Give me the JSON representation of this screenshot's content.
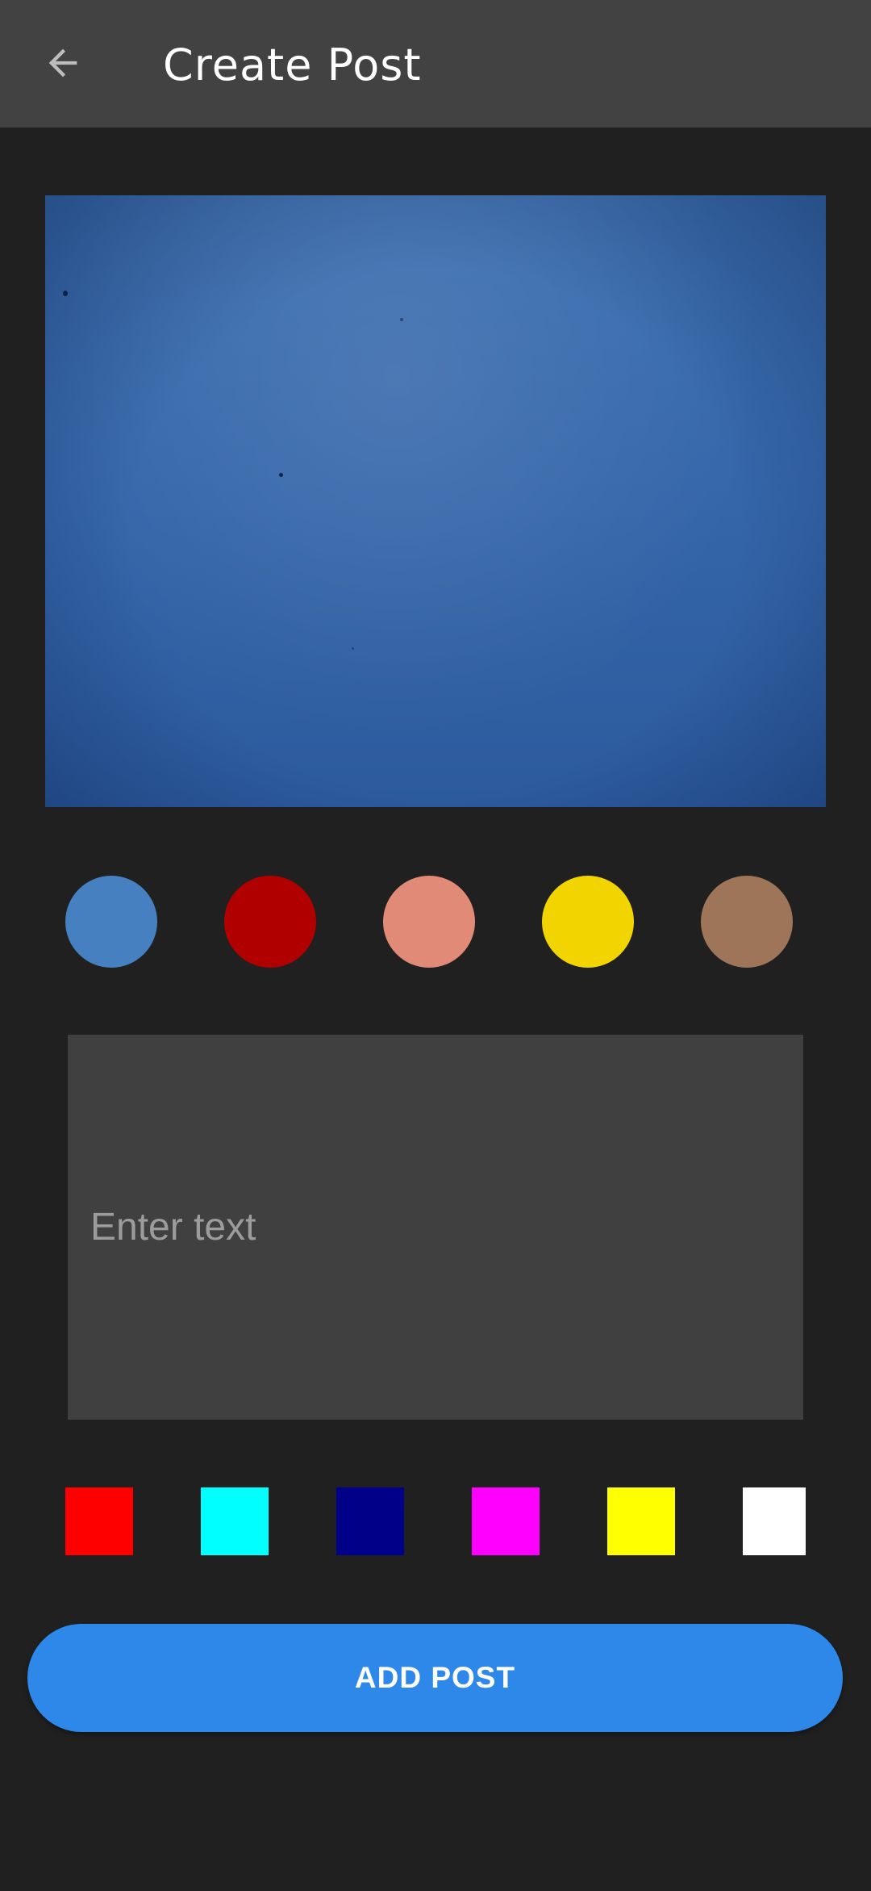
{
  "header": {
    "title": "Create Post",
    "back_icon": "arrow-left-icon"
  },
  "preview": {
    "description_color": "#3566aa"
  },
  "background_colors": [
    {
      "name": "steel-blue",
      "color": "#4680c0"
    },
    {
      "name": "dark-red",
      "color": "#b00000"
    },
    {
      "name": "salmon",
      "color": "#e28a78"
    },
    {
      "name": "gold",
      "color": "#f2d500"
    },
    {
      "name": "brown",
      "color": "#9e7558"
    }
  ],
  "text_input": {
    "placeholder": "Enter text",
    "value": ""
  },
  "text_colors": [
    {
      "name": "red",
      "color": "#ff0000"
    },
    {
      "name": "cyan",
      "color": "#00ffff"
    },
    {
      "name": "navy",
      "color": "#000088"
    },
    {
      "name": "magenta",
      "color": "#ff00ff"
    },
    {
      "name": "yellow",
      "color": "#ffff00"
    },
    {
      "name": "white",
      "color": "#ffffff"
    }
  ],
  "actions": {
    "add_post_label": "ADD POST",
    "accent_color": "#2d88ea"
  }
}
